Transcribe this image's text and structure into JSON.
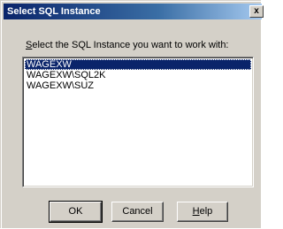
{
  "window": {
    "title": "Select SQL Instance",
    "close_glyph": "x"
  },
  "dialog": {
    "instruction_prefix": "S",
    "instruction_rest": "elect the SQL Instance you want to work with:",
    "instances": [
      "WAGEXW",
      "WAGEXW\\SQL2K",
      "WAGEXW\\SUZ"
    ],
    "selected_index": 0
  },
  "buttons": {
    "ok_label": "OK",
    "cancel_label": "Cancel",
    "help_prefix": "H",
    "help_rest": "elp"
  },
  "colors": {
    "title_active": "#0a246a",
    "selection": "#0a246a",
    "face": "#d4d0c8"
  }
}
